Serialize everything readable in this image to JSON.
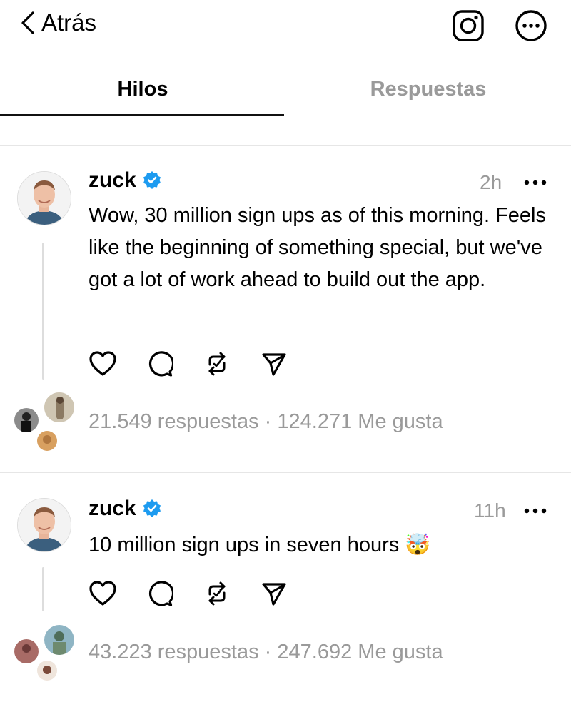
{
  "header": {
    "back_label": "Atrás",
    "instagram_icon": "instagram-icon",
    "more_icon": "more-circle-icon"
  },
  "tabs": [
    {
      "label": "Hilos",
      "active": true
    },
    {
      "label": "Respuestas",
      "active": false
    }
  ],
  "posts": [
    {
      "username": "zuck",
      "verified": true,
      "time": "2h",
      "text": "Wow, 30 million sign ups as of this morning. Feels like the beginning of something special, but we've got a lot of work ahead to build out the app.",
      "replies": "21.549 respuestas",
      "separator": " · ",
      "likes": "124.271 Me gusta"
    },
    {
      "username": "zuck",
      "verified": true,
      "time": "11h",
      "text": "10 million sign ups in seven hours",
      "emoji": "🤯",
      "replies": "43.223 respuestas",
      "separator": " · ",
      "likes": "247.692 Me gusta"
    }
  ],
  "colors": {
    "verified": "#1d9bf0",
    "muted": "#9a9a9a",
    "divider": "#e6e6e6"
  }
}
